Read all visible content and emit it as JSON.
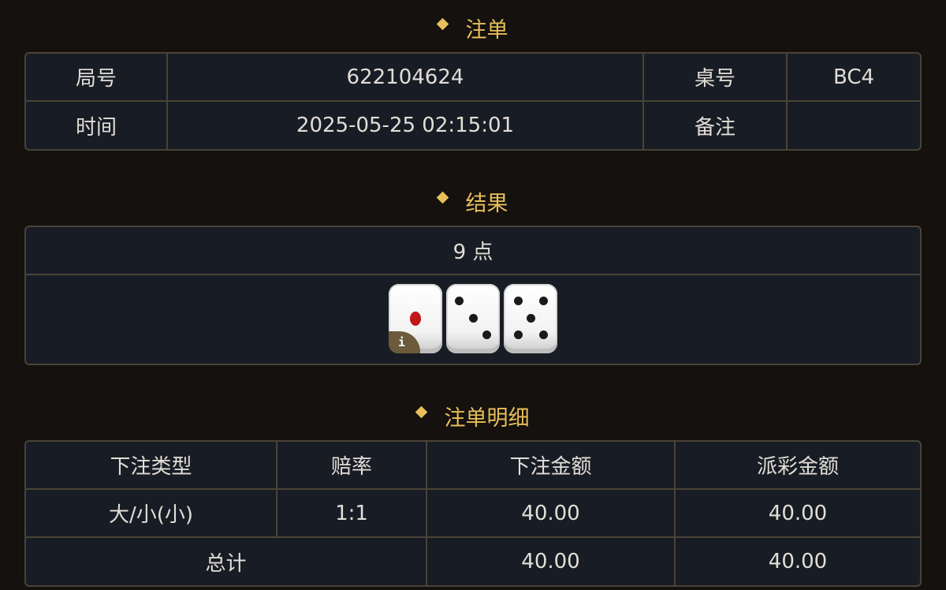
{
  "order": {
    "title": "注单",
    "round_label": "局号",
    "round_value": "622104624",
    "table_label": "桌号",
    "table_value": "BC4",
    "time_label": "时间",
    "time_value": "2025-05-25 02:15:01",
    "note_label": "备注",
    "note_value": ""
  },
  "result": {
    "title": "结果",
    "points": "9 点",
    "dice": [
      1,
      3,
      5
    ],
    "info_icon": "i"
  },
  "details": {
    "title": "注单明细",
    "headers": [
      "下注类型",
      "赔率",
      "下注金额",
      "派彩金额"
    ],
    "rows": [
      {
        "type": "大/小(小)",
        "odds": "1:1",
        "bet": "40.00",
        "payout": "40.00"
      }
    ],
    "total": {
      "label": "总计",
      "bet": "40.00",
      "payout": "40.00"
    },
    "odds_color": "#d21f1f"
  },
  "colors": {
    "accent": "#e8bf5a",
    "background": "#14110e",
    "panel": "#181c25",
    "border": "#4a4437"
  }
}
